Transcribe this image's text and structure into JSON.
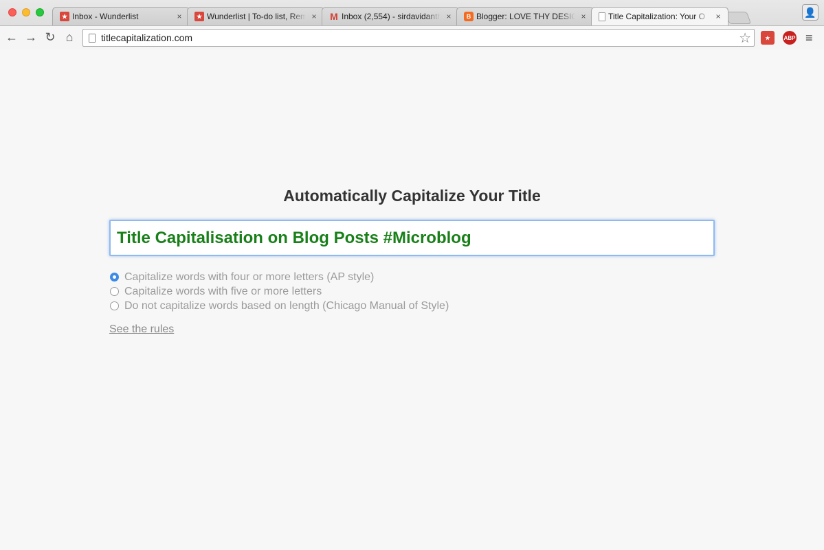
{
  "browser": {
    "tabs": [
      {
        "title": "Inbox - Wunderlist",
        "favicon": "wunderlist-icon",
        "active": false
      },
      {
        "title": "Wunderlist | To-do list, Rem",
        "favicon": "wunderlist-icon",
        "active": false
      },
      {
        "title": "Inbox (2,554) - sirdavidanth",
        "favicon": "gmail-icon",
        "active": false
      },
      {
        "title": "Blogger: LOVE THY DESIG",
        "favicon": "blogger-icon",
        "active": false
      },
      {
        "title": "Title Capitalization: Your O",
        "favicon": "page-icon",
        "active": true
      }
    ],
    "close_glyph": "×",
    "url": "titlecapitalization.com",
    "extensions": {
      "abp_label": "ABP"
    }
  },
  "page": {
    "heading": "Automatically Capitalize Your Title",
    "title_value": "Title Capitalisation on Blog Posts #Microblog",
    "options": [
      {
        "label": "Capitalize words with four or more letters (AP style)",
        "checked": true
      },
      {
        "label": "Capitalize words with five or more letters",
        "checked": false
      },
      {
        "label": "Do not capitalize words based on length (Chicago Manual of Style)",
        "checked": false
      }
    ],
    "rules_link": "See the rules"
  },
  "colors": {
    "title_text": "#198019",
    "radio_accent": "#3d8be6",
    "page_background": "#f7f7f7"
  }
}
